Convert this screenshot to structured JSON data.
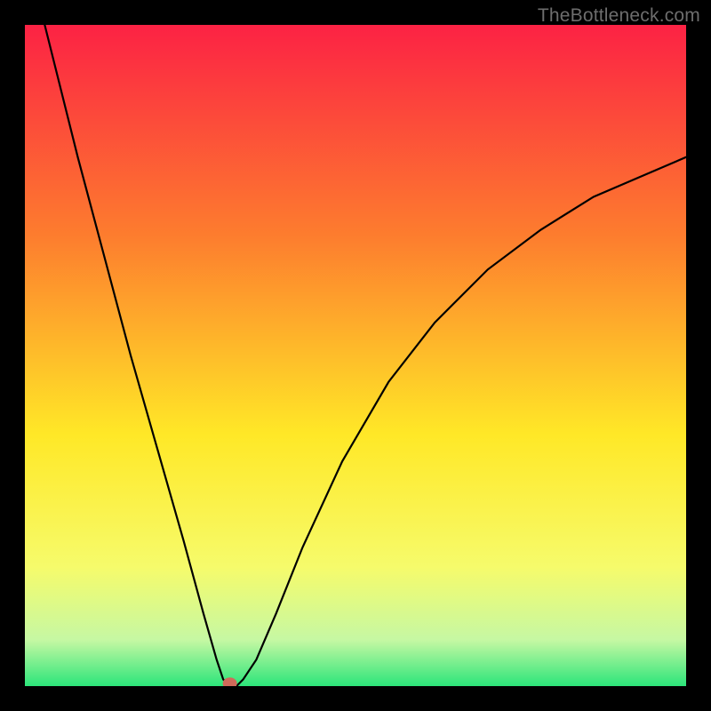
{
  "watermark": "TheBottleneck.com",
  "chart_data": {
    "type": "line",
    "title": "",
    "xlabel": "",
    "ylabel": "",
    "xlim": [
      0,
      100
    ],
    "ylim": [
      0,
      100
    ],
    "grid": false,
    "legend": false,
    "background_gradient": {
      "top": "#fc2244",
      "mid_upper": "#fd7d2e",
      "mid": "#ffe827",
      "mid_lower": "#f6fb6b",
      "low": "#c6f8a3",
      "bottom": "#2ce57a"
    },
    "series": [
      {
        "name": "bottleneck-curve",
        "x": [
          3,
          5,
          8,
          12,
          16,
          20,
          24,
          27,
          29,
          30,
          31,
          32,
          33,
          35,
          38,
          42,
          48,
          55,
          62,
          70,
          78,
          86,
          93,
          100
        ],
        "y": [
          100,
          92,
          80,
          65,
          50,
          36,
          22,
          11,
          4,
          1,
          0,
          0,
          1,
          4,
          11,
          21,
          34,
          46,
          55,
          63,
          69,
          74,
          77,
          80
        ]
      }
    ],
    "marker": {
      "name": "optimal-point",
      "x": 31,
      "y": 0,
      "color": "#d06a5a",
      "radius": 8
    }
  }
}
